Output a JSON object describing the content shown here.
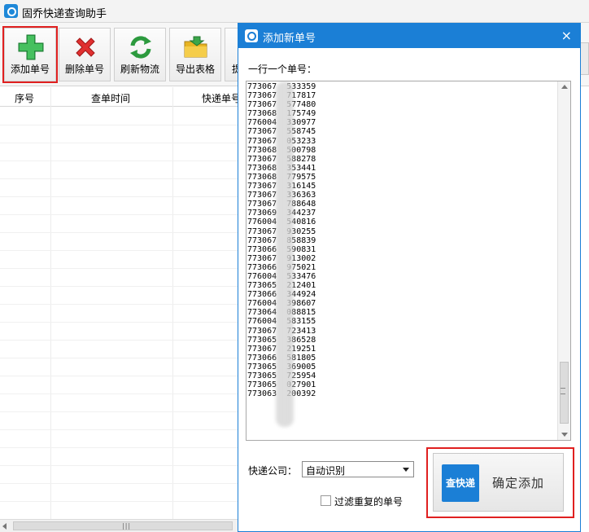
{
  "app": {
    "title": "固乔快递查询助手"
  },
  "toolbar": {
    "add_label": "添加单号",
    "delete_label": "删除单号",
    "refresh_label": "刷新物流",
    "export_label": "导出表格",
    "partial_label": "提"
  },
  "grid": {
    "columns": [
      "序号",
      "查单时间",
      "快递单号"
    ]
  },
  "dialog": {
    "title": "添加新单号",
    "close": "×",
    "input_label": "一行一个单号：",
    "tracking_numbers": [
      "773067  533359",
      "773067  717817",
      "773067  577480",
      "773068  175749",
      "776004  330977",
      "773067  558745",
      "773067  053233",
      "773068  500798",
      "773067  588278",
      "773068  353441",
      "773068  779575",
      "773067  316145",
      "773067  336363",
      "773067  788648",
      "773069  344237",
      "776004  540816",
      "773067  930255",
      "773067  858839",
      "773066  590831",
      "773067  913002",
      "773066  975021",
      "776004  533476",
      "773065  212401",
      "773066  344924",
      "776004  398607",
      "773064  088815",
      "776004  583155",
      "773067  723413",
      "773065  386528",
      "773067  219251",
      "773066  581805",
      "773065  369005",
      "773065  725954",
      "773065  027901",
      "773063  200392"
    ],
    "courier_label": "快递公司：",
    "courier_value": "自动识别",
    "filter_label": "过滤重复的单号",
    "confirm_badge": "查快递",
    "confirm_label": "确定添加"
  },
  "colors": {
    "accent": "#1b7fd6",
    "highlight": "#e02020"
  }
}
